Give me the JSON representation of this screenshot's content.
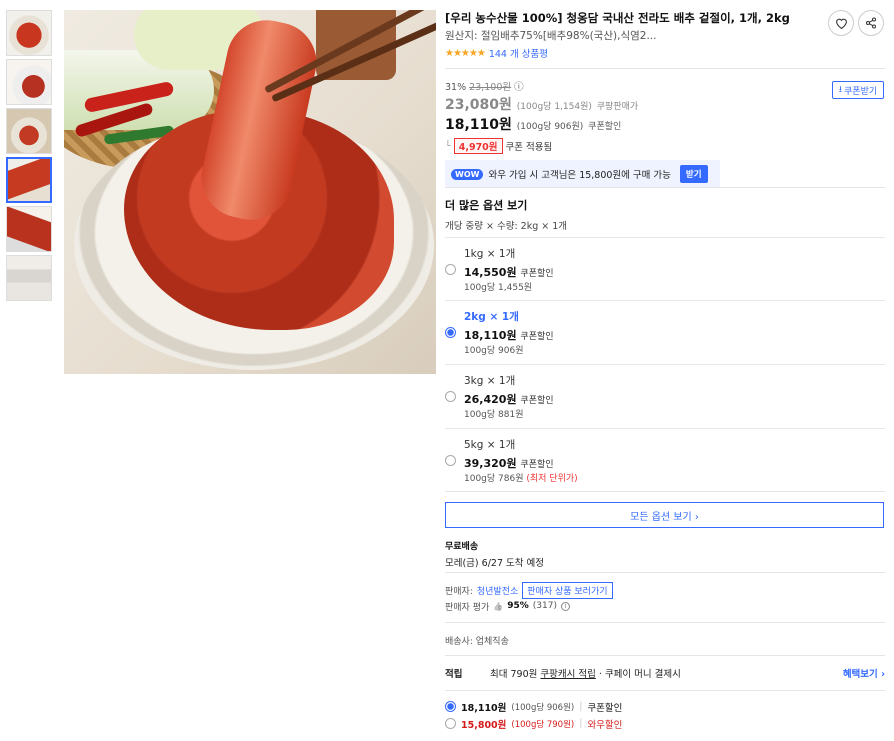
{
  "product": {
    "title": "[우리 농수산물 100%] 청옹담 국내산 전라도 배추 겉절이, 1개, 2kg",
    "origin": "원산지: 절임배추75%[배추98%(국산),식염2...",
    "stars": "★★★★★",
    "review_count": "144 개 상품평",
    "rating_value": 4.5
  },
  "icons": {
    "heart": "heart-icon",
    "share": "share-icon"
  },
  "price": {
    "discount_rate": "31%",
    "original": "23,100원",
    "info_mark": "ⓘ",
    "sale_price": "23,080원",
    "sale_unit": "(100g당 1,154원)",
    "sale_label": "쿠팡판매가",
    "coupon_price": "18,110원",
    "coupon_unit": "(100g당 906원)",
    "coupon_label": "쿠폰할인",
    "coupon_amount": "4,970원",
    "coupon_applied": "쿠폰 적용됨",
    "coupon_button": "쿠폰받기",
    "wow_badge": "WOW",
    "wow_text": "와우 가입 시 고객님은 15,800원에 구매 가능",
    "wow_join": "받기"
  },
  "options": {
    "title": "더 많은 옵션 보기",
    "selected_summary": "개당 중량 × 수량: 2kg × 1개",
    "items": [
      {
        "name": "1kg × 1개",
        "price": "14,550원",
        "tag": "쿠폰할인",
        "per": "100g당 1,455원",
        "lowest": "",
        "selected": false
      },
      {
        "name": "2kg × 1개",
        "price": "18,110원",
        "tag": "쿠폰할인",
        "per": "100g당 906원",
        "lowest": "",
        "selected": true
      },
      {
        "name": "3kg × 1개",
        "price": "26,420원",
        "tag": "쿠폰할인",
        "per": "100g당 881원",
        "lowest": "",
        "selected": false
      },
      {
        "name": "5kg × 1개",
        "price": "39,320원",
        "tag": "쿠폰할인",
        "per": "100g당 786원",
        "lowest": "(최저 단위가)",
        "selected": false
      }
    ],
    "all_button": "모든 옵션 보기 ›"
  },
  "shipping": {
    "type": "무료배송",
    "arrival": "모레(금) 6/27 도착 예정"
  },
  "seller": {
    "label": "판매자:",
    "name": "청년발전소",
    "go_button": "판매자 상품 보러가기",
    "rating_label": "판매자 평가",
    "thumb": "👍",
    "rating_pct": "95%",
    "rating_count": "(317)",
    "info_mark": "i"
  },
  "courier": "배송사: 업체직송",
  "reward": {
    "label": "적립",
    "text_a": "최대 790원",
    "text_b": "쿠팡캐시 적립",
    "text_c": "· 쿠페이 머니 결제시",
    "more": "혜택보기 ›"
  },
  "payment": [
    {
      "amount": "18,110원",
      "unit": "(100g당 906원)",
      "tag": "쿠폰할인",
      "selected": true,
      "red": false
    },
    {
      "amount": "15,800원",
      "unit": "(100g당 790원)",
      "tag": "와우할인",
      "selected": false,
      "red": true
    }
  ],
  "colors": {
    "accent": "#346aff",
    "sale_red": "#d61b1b",
    "star": "#f5a623"
  }
}
